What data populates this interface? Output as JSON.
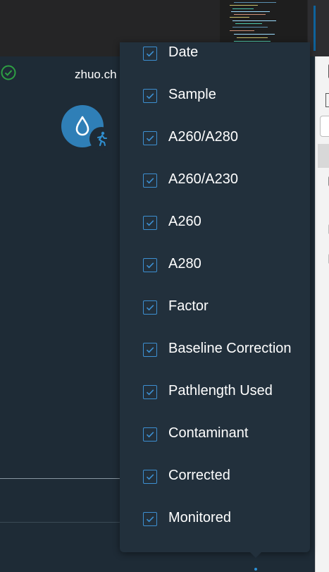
{
  "user": {
    "name": "zhuo.ch"
  },
  "columns_menu": {
    "items": [
      {
        "label": "Date",
        "checked": true
      },
      {
        "label": "Sample",
        "checked": true
      },
      {
        "label": "A260/A280",
        "checked": true
      },
      {
        "label": "A260/A230",
        "checked": true
      },
      {
        "label": "A260",
        "checked": true
      },
      {
        "label": "A280",
        "checked": true
      },
      {
        "label": "Factor",
        "checked": true
      },
      {
        "label": "Baseline Correction",
        "checked": true
      },
      {
        "label": "Pathlength Used",
        "checked": true
      },
      {
        "label": "Contaminant",
        "checked": true
      },
      {
        "label": "Corrected",
        "checked": true
      },
      {
        "label": "Monitored",
        "checked": true
      }
    ]
  },
  "colors": {
    "background": "#1e2b36",
    "menu_background": "#22303c",
    "checkbox_accent": "#3d8fd1",
    "status_green": "#2ea043",
    "avatar_blue": "#2f7fb7"
  },
  "icons": {
    "status": "check-circle-icon",
    "avatar": "water-drop-icon",
    "avatar_badge": "running-person-icon",
    "checkbox": "checkmark-icon"
  }
}
